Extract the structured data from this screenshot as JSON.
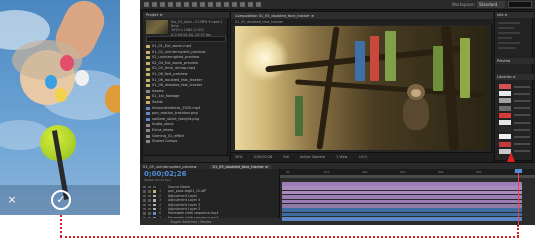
{
  "colors": {
    "accent_blue": "#4f8fd8",
    "highlight_red": "#e02020",
    "dotted_line": "#d91e1e",
    "panel_bg": "#232323",
    "app_bg": "#1d1d1d"
  },
  "phone": {
    "close_icon": "×",
    "confirm_icon": "✓"
  },
  "app": {
    "workspace_label": "Workspace:",
    "workspace_value": "Standard"
  },
  "project_panel": {
    "tab": "Project ≡",
    "info_lines": [
      "Ext_01_dom...01.MP4 ▾ used 1 time",
      "1920 x 1080 (1.00)",
      "Δ 0;00;04;04, 29.97 fps",
      "Millions of Colors+ (Straight)"
    ],
    "items": [
      {
        "label": "01_01_Ext_zoom.mp4",
        "color": "#c9b26a"
      },
      {
        "label": "01_02_uninterrupted_preview",
        "color": "#c9b26a"
      },
      {
        "label": "02_uninterrupted_preview",
        "color": "#c9b26a"
      },
      {
        "label": "02_04_Ext_zoom_preview",
        "color": "#c9b26a"
      },
      {
        "label": "02_05_time_remap.mp4",
        "color": "#c9b26a"
      },
      {
        "label": "01_06_fast_preview",
        "color": "#c9b26a"
      },
      {
        "label": "01_06_doubled_fast_tracker",
        "color": "#c9b26a"
      },
      {
        "label": "01_06_dissolve_fast_tracker",
        "color": "#c9b26a"
      },
      {
        "label": "Assets",
        "color": "#8a8a8a"
      },
      {
        "label": "01_1st_footage",
        "color": "#c9b26a"
      },
      {
        "label": "Solids",
        "color": "#c9b26a"
      },
      {
        "label": "intoxicatedintro_1920.mp4",
        "color": "#5d8fc9"
      },
      {
        "label": "pan_motion_trackbar.png",
        "color": "#5d8fc9"
      },
      {
        "label": "solitare_stock_tonight.png",
        "color": "#5d8fc9"
      },
      {
        "label": "Audio_stock",
        "color": "#8a8a8a"
      },
      {
        "label": "Extra_demo",
        "color": "#8a8a8a"
      },
      {
        "label": "Gaming_01_effect",
        "color": "#8a8a8a"
      },
      {
        "label": "Stored Comps",
        "color": "#8a8a8a"
      }
    ]
  },
  "composition": {
    "tab": "Composition 01_05_doubled_face_tracker ≡",
    "sub_tab": "01_05_doubled_face_tracker",
    "footer_items": [
      "50%",
      "0;00;02;26",
      "Full",
      "Active Camera",
      "1 View",
      "+0.0"
    ]
  },
  "right_panel": {
    "info_tab": "Info ≡",
    "preview_tab": "Preview",
    "libraries_tab": "Libraries ≡",
    "swatches": [
      "#d65252",
      "#e8e8e8",
      "#a0a0a0",
      "#6a6a6a",
      "#d63a3a",
      "#e6e6e6",
      "#2a2a2a",
      "#efefef",
      "#c23a3a",
      "#c8c8c8"
    ]
  },
  "timeline": {
    "tabs": [
      {
        "label": "01_05_uninterrupted_preview",
        "active": false
      },
      {
        "label": "01_05_doubled_face_tracker ≡",
        "active": true
      }
    ],
    "timecode": "0;00;02;26",
    "fps": "00086 (29.97 fps)",
    "layers": [
      {
        "num": "",
        "label": "Source Name",
        "color": "#555555",
        "selected": false
      },
      {
        "num": "1",
        "label": "pan_pass-tag01_12.AIP",
        "color": "#c9b26a",
        "selected": false
      },
      {
        "num": "2",
        "label": "Adjustment Layer",
        "color": "#b0b0b0",
        "selected": false
      },
      {
        "num": "3",
        "label": "Adjustment Layer 4",
        "color": "#b0b0b0",
        "selected": false
      },
      {
        "num": "4",
        "label": "Adjustment Layer 3",
        "color": "#b0b0b0",
        "selected": false
      },
      {
        "num": "5",
        "label": "Adjustment Layer 2",
        "color": "#b0b0b0",
        "selected": false
      },
      {
        "num": "6",
        "label": "Moveable cloth sequence.mp4",
        "color": "#5d8fc9",
        "selected": false
      },
      {
        "num": "7",
        "label": "Moveable cloth sequence.mp4",
        "color": "#5d8fc9",
        "selected": false
      },
      {
        "num": "8",
        "label": "IntoxicatedFace_1920.mp4",
        "color": "#5d8fc9",
        "selected": true
      },
      {
        "num": "",
        "label": "Effects",
        "color": "#555555",
        "selected": false
      },
      {
        "num": "",
        "label": "Transform",
        "color": "#555555",
        "selected": false
      }
    ],
    "bottom_label": "Toggle Switches / Modes",
    "ruler_ticks": [
      "0s",
      "01s",
      "02s",
      "03s",
      "04s",
      "05s",
      "06s"
    ],
    "track_colors": [
      "#9a7fb8",
      "#a98abf",
      "#a98abf",
      "#9b7db5",
      "#9b7db5",
      "#8f7aa8",
      "#3d6da3",
      "#3d6da3",
      "#5a86c4"
    ]
  }
}
